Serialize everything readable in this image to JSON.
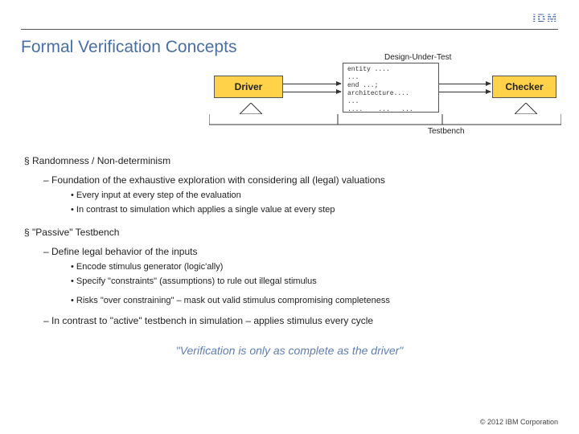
{
  "brand": {
    "name": "IBM"
  },
  "title": "Formal Verification Concepts",
  "diagram": {
    "dut_label": "Design-Under-Test",
    "driver": "Driver",
    "checker": "Checker",
    "testbench": "Testbench",
    "code": "entity ....\n...\nend ...;\narchitecture....\n...\n....    ...   ...\n....\nend ....."
  },
  "bullets": {
    "b1": "Randomness / Non-determinism",
    "b1_1": "Foundation of the exhaustive exploration with considering all (legal) valuations",
    "b1_1_a": "Every input at every step of the evaluation",
    "b1_1_b": "In contrast to simulation which applies a single value at every step",
    "b2": "\"Passive\" Testbench",
    "b2_1": "Define legal behavior of the inputs",
    "b2_1_a": "Encode stimulus generator (logic'ally)",
    "b2_1_b": "Specify \"constraints\" (assumptions) to rule out illegal stimulus",
    "b2_1_c": "Risks \"over constraining\" – mask out valid stimulus compromising completeness",
    "b2_2": "In contrast to \"active\" testbench in simulation – applies stimulus every cycle"
  },
  "quote": "\"Verification is only as complete as the driver\"",
  "footer": "© 2012 IBM Corporation"
}
